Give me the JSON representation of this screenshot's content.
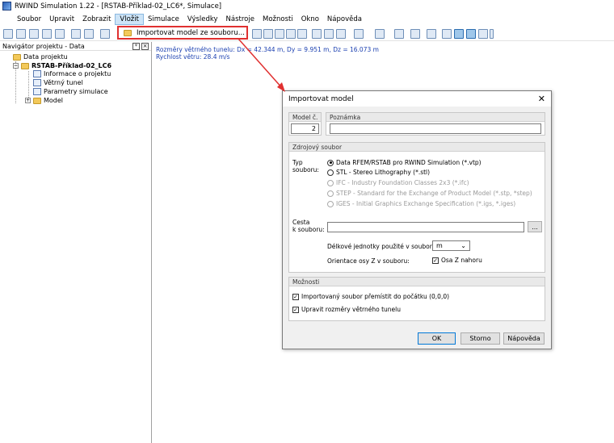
{
  "window": {
    "title": "RWIND Simulation 1.22 - [RSTAB-Příklad-02_LC6*, Simulace]"
  },
  "menu": {
    "items": [
      "Soubor",
      "Upravit",
      "Zobrazit",
      "Vložit",
      "Simulace",
      "Výsledky",
      "Nástroje",
      "Možnosti",
      "Okno",
      "Nápověda"
    ],
    "active": "Vložit"
  },
  "dropdown": {
    "item_label": "Importovat model ze souboru..."
  },
  "navigator": {
    "title": "Navigátor projektu - Data",
    "root": "Data projektu",
    "project": "RSTAB-Příklad-02_LC6",
    "children": [
      "Informace o projektu",
      "Větrný tunel",
      "Parametry simulace",
      "Model"
    ]
  },
  "info": {
    "line1": "Rozměry větrného tunelu: Dx = 42.344 m, Dy = 9.951 m, Dz = 16.073 m",
    "line2": "Rychlost větru: 28.4 m/s"
  },
  "dialog": {
    "title": "Importovat model",
    "model_no_label": "Model č.",
    "model_no_value": "2",
    "note_label": "Poznámka",
    "note_value": "",
    "source_group": "Zdrojový soubor",
    "file_type_label_1": "Typ",
    "file_type_label_2": "souboru:",
    "file_types": [
      "Data RFEM/RSTAB pro RWIND Simulation (*.vtp)",
      "STL - Stereo Lithography (*.stl)",
      "IFC - Industry Foundation Classes 2x3 (*.ifc)",
      "STEP - Standard for the Exchange of Product Model (*.stp, *step)",
      "IGES - Initial Graphics Exchange Specification (*.igs, *.iges)"
    ],
    "path_label_1": "Cesta",
    "path_label_2": "k souboru:",
    "path_value": "",
    "browse_label": "...",
    "units_label": "Délkové jednotky použité v souboru:",
    "units_value": "m",
    "orientation_label": "Orientace osy Z v souboru:",
    "orientation_checkbox": "Osa Z nahoru",
    "options_group": "Možnosti",
    "option1": "Importovaný soubor přemístit do počátku (0,0,0)",
    "option2": "Upravit rozměry větrného tunelu",
    "ok": "OK",
    "cancel": "Storno",
    "help": "Nápověda"
  },
  "colors": {
    "highlight_red": "#e03030",
    "info_blue": "#1a3fb0",
    "accent": "#0078d7"
  }
}
